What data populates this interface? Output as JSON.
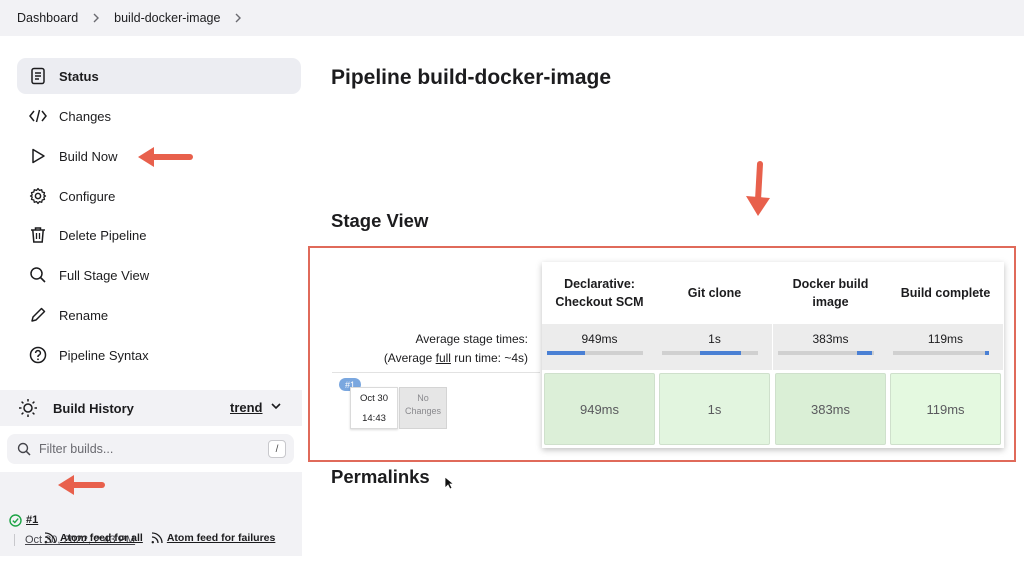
{
  "breadcrumb": {
    "items": [
      "Dashboard",
      "build-docker-image"
    ]
  },
  "sidebar": {
    "items": [
      {
        "label": "Status",
        "icon": "document-icon",
        "active": true
      },
      {
        "label": "Changes",
        "icon": "code-icon"
      },
      {
        "label": "Build Now",
        "icon": "play-icon"
      },
      {
        "label": "Configure",
        "icon": "gear-icon"
      },
      {
        "label": "Delete Pipeline",
        "icon": "trash-icon"
      },
      {
        "label": "Full Stage View",
        "icon": "search-icon"
      },
      {
        "label": "Rename",
        "icon": "pencil-icon"
      },
      {
        "label": "Pipeline Syntax",
        "icon": "help-circle-icon"
      }
    ]
  },
  "build_history": {
    "title": "Build History",
    "trend_label": "trend",
    "filter_placeholder": "Filter builds...",
    "filter_shortcut": "/",
    "builds": [
      {
        "number": "#1",
        "date": "Oct 30, 2022, 2:43 PM",
        "status": "success"
      }
    ],
    "feeds": [
      "Atom feed for all",
      "Atom feed for failures"
    ]
  },
  "main": {
    "title": "Pipeline build-docker-image",
    "stage_view_heading": "Stage View",
    "permalinks_heading": "Permalinks"
  },
  "stage_view": {
    "avg_label_line1": "Average stage times:",
    "avg_label_pre": "(Average ",
    "avg_label_link": "full",
    "avg_label_post": " run time: ~4s)",
    "stages": [
      {
        "name": "Declarative: Checkout SCM",
        "avg": "949ms",
        "bar_start": 0.0,
        "bar_fraction": 0.4,
        "cell": "949ms",
        "cell_color": "#dcefd8"
      },
      {
        "name": "Git clone",
        "avg": "1s",
        "bar_start": 0.4,
        "bar_fraction": 0.42,
        "cell": "1s",
        "cell_color": "#e2f5df"
      },
      {
        "name": "Docker build image",
        "avg": "383ms",
        "bar_start": 0.82,
        "bar_fraction": 0.16,
        "cell": "383ms",
        "cell_color": "#daefd6"
      },
      {
        "name": "Build complete",
        "avg": "119ms",
        "bar_start": 0.96,
        "bar_fraction": 0.04,
        "cell": "119ms",
        "cell_color": "#e4f9e0"
      }
    ],
    "run": {
      "badge": "#1",
      "date": "Oct 30",
      "time": "14:43",
      "changes": "No Changes"
    }
  },
  "colors": {
    "accent": "#4a80d4",
    "highlight_border": "#e06a5a",
    "arrow": "#e8604c",
    "success": "#1ea446"
  }
}
